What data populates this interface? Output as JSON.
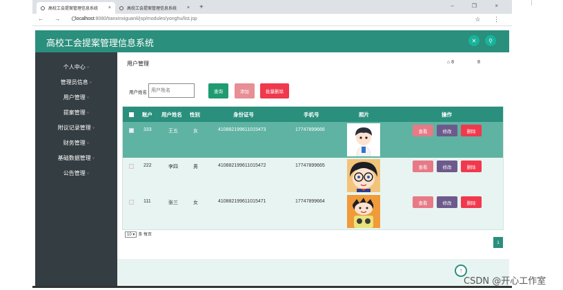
{
  "browser": {
    "tabs": [
      {
        "title": "高校工会提案管理信息系统",
        "close": "×"
      },
      {
        "title": "高校工会提案管理信息系统",
        "close": "×"
      }
    ],
    "new_tab": "+",
    "window_controls": "–  ❐  ×",
    "nav": "← → C",
    "url_host": "localhost",
    "url_path": ":8080/tianxinxiguanli/jsp/modules/yonghu/list.jsp",
    "addr_icons": "☆ ⋮"
  },
  "header": {
    "title": "高校工会提案管理信息系统",
    "btn1_icon": "✕",
    "btn2_icon": "⚲"
  },
  "sidebar": {
    "items": [
      {
        "label": "个人中心"
      },
      {
        "label": "管理员信息"
      },
      {
        "label": "用户管理"
      },
      {
        "label": "提案管理"
      },
      {
        "label": "附议记录管理"
      },
      {
        "label": "财务管理"
      },
      {
        "label": "基础数据管理"
      },
      {
        "label": "公告管理"
      }
    ],
    "caret": "˅"
  },
  "page": {
    "title": "用户管理",
    "crumb_home": "⌂ 8",
    "crumb_sep": "8"
  },
  "search": {
    "label": "用户姓名",
    "placeholder": "用户姓名",
    "query_btn": "查询",
    "add_btn": "添加",
    "batch_delete_btn": "批量删除"
  },
  "table": {
    "headers": [
      "账户",
      "用户姓名",
      "性别",
      "身份证号",
      "手机号",
      "照片",
      "操作"
    ],
    "rows": [
      {
        "account": "333",
        "name": "王五",
        "gender": "女",
        "id_card": "410882199611015473",
        "phone": "17747899666"
      },
      {
        "account": "222",
        "name": "李四",
        "gender": "男",
        "id_card": "410882199611015472",
        "phone": "17747899665"
      },
      {
        "account": "111",
        "name": "张三",
        "gender": "女",
        "id_card": "410882199611015471",
        "phone": "17747899664"
      }
    ],
    "actions": {
      "view": "查看",
      "edit": "修改",
      "delete": "删除"
    }
  },
  "pager": {
    "page_size": "10",
    "per_page_text": "条 每页",
    "current_page": "1"
  },
  "watermark": "CSDN @开心工作室",
  "colors": {
    "primary": "#2a8f7c",
    "sidebar": "#343d42",
    "row_selected": "#5fb3a2",
    "row_alt": "#e8f4f1",
    "view": "#e77a86",
    "edit": "#6d5a8c",
    "delete": "#f0394d",
    "add": "#e88e95",
    "batch_delete": "#f0394d"
  }
}
